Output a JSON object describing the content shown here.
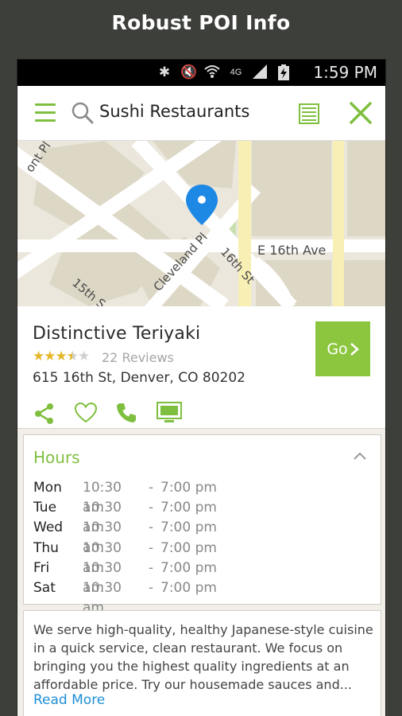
{
  "promo": {
    "title": "Robust POI Info"
  },
  "status_bar": {
    "time": "1:59 PM",
    "network": "4G"
  },
  "search": {
    "query": "Sushi Restaurants"
  },
  "map": {
    "street_labels": [
      "ont Pl",
      "Cleveland Pl",
      "16th St",
      "E 16th Ave",
      "15th S"
    ]
  },
  "poi": {
    "name": "Distinctive  Teriyaki",
    "rating": 3.5,
    "rating_max": 5,
    "reviews": "22 Reviews",
    "address": "615 16th St, Denver, CO  80202",
    "go_label": "Go"
  },
  "hours": {
    "title": "Hours",
    "rows": [
      {
        "day": "Mon",
        "open": "10:30 am",
        "close": "7:00 pm"
      },
      {
        "day": "Tue",
        "open": "10:30 am",
        "close": "7:00 pm"
      },
      {
        "day": "Wed",
        "open": "10:30 am",
        "close": "7:00 pm"
      },
      {
        "day": "Thu",
        "open": "10:30 am",
        "close": "7:00 pm"
      },
      {
        "day": "Fri",
        "open": "10:30 am",
        "close": "7:00 pm"
      },
      {
        "day": "Sat",
        "open": "10:30 am",
        "close": "7:00 pm"
      }
    ],
    "separator": "-"
  },
  "description": {
    "text": "We serve high-quality, healthy Japanese-style cuisine in a quick service, clean restaurant. We focus on bringing you the highest quality ingredients at an affordable price. Try our housemade sauces and...",
    "read_more": "Read More"
  },
  "colors": {
    "accent": "#8cc63f",
    "link": "#1e8fd6",
    "star": "#e5b72a"
  }
}
